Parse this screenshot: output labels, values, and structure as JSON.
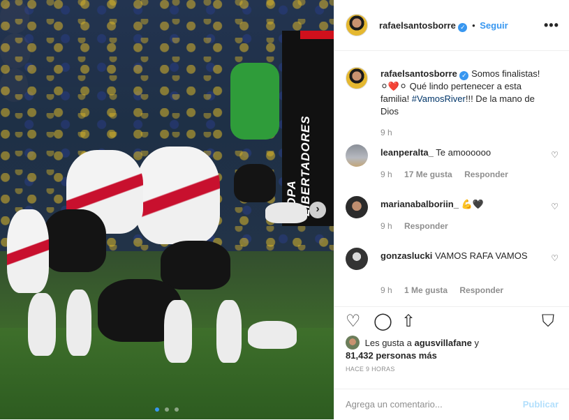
{
  "header": {
    "username": "rafaelsantosborre",
    "dot": "•",
    "follow_label": "Seguir",
    "more_label": "•••"
  },
  "caption": {
    "username": "rafaelsantosborre",
    "text_before": "Somos finalistas! ⚪❤️⚪ Qué lindo pertenecer a esta familia! ",
    "hashtag": "#VamosRiver",
    "text_after": "!!! De la mano de Dios",
    "time": "9 h"
  },
  "comments": [
    {
      "username": "leanperalta_",
      "text": "Te amoooooo",
      "time": "9 h",
      "likes": "17 Me gusta",
      "reply": "Responder"
    },
    {
      "username": "marianabalboriin_",
      "text": "💪🖤",
      "time": "9 h",
      "likes": "",
      "reply": "Responder"
    },
    {
      "username": "gonzaslucki",
      "text": "VAMOS RAFA VAMOS",
      "time": "9 h",
      "likes": "1 Me gusta",
      "reply": "Responder"
    }
  ],
  "likes": {
    "prefix": "Les gusta a",
    "user": "agusvillafane",
    "connector": "y",
    "count": "81,432 personas más"
  },
  "timestamp": "HACE 9 HORAS",
  "add_comment": {
    "placeholder": "Agrega un comentario...",
    "publish_label": "Publicar"
  },
  "media": {
    "banner_text": "COPA LIBERTADORES",
    "next_icon": "›"
  },
  "icons": {
    "heart": "♡",
    "comment": "◯",
    "share": "⇧",
    "bookmark": "⛉"
  },
  "colors": {
    "accent": "#3897f0",
    "muted": "#8e8e8e",
    "publish_disabled": "#b2dffc",
    "hashtag": "#003569"
  }
}
